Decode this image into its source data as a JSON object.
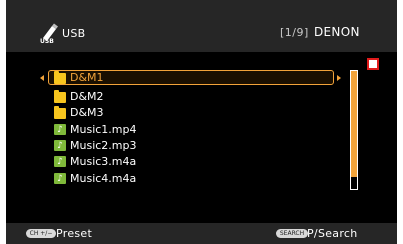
{
  "header": {
    "source_icon": "usb-stick-icon",
    "source_label": "USB",
    "page_indicator": "[1/9]",
    "brand": "DENON"
  },
  "list": {
    "items": [
      {
        "label": "D&M1",
        "icon": "folder-icon",
        "selected": true
      },
      {
        "label": "D&M2",
        "icon": "folder-icon",
        "selected": false
      },
      {
        "label": "D&M3",
        "icon": "folder-icon",
        "selected": false
      },
      {
        "label": "Music1.mp4",
        "icon": "music-note-icon",
        "selected": false
      },
      {
        "label": "Music2.mp3",
        "icon": "music-note-icon",
        "selected": false
      },
      {
        "label": "Music3.m4a",
        "icon": "music-note-icon",
        "selected": false
      },
      {
        "label": "Music4.m4a",
        "icon": "music-note-icon",
        "selected": false
      }
    ],
    "music_glyph": "♪"
  },
  "scrollbar": {
    "position_fraction": 0.9
  },
  "footer": {
    "left_badge": "CH +/−",
    "left_label": "Preset",
    "right_badge": "SEARCH",
    "right_label": "P/Search"
  },
  "colors": {
    "accent": "#f2a33a",
    "folder": "#f7c51e",
    "music": "#7fb93a",
    "indicator_red": "#e01b1b",
    "bar": "#262626"
  }
}
